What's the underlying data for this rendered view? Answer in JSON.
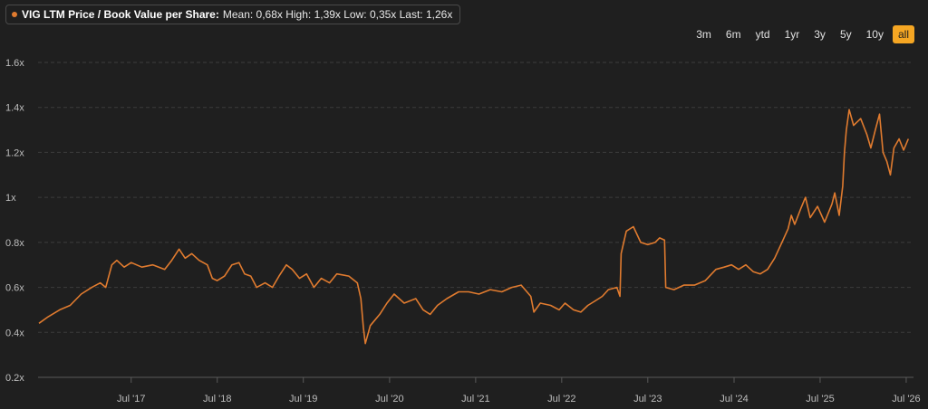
{
  "legend": {
    "series_name": "VIG LTM Price / Book Value per Share:",
    "stats": "Mean: 0,68x High: 1,39x Low: 0,35x Last: 1,26x"
  },
  "range_buttons": [
    {
      "label": "3m",
      "active": false
    },
    {
      "label": "6m",
      "active": false
    },
    {
      "label": "ytd",
      "active": false
    },
    {
      "label": "1yr",
      "active": false
    },
    {
      "label": "3y",
      "active": false
    },
    {
      "label": "5y",
      "active": false
    },
    {
      "label": "10y",
      "active": false
    },
    {
      "label": "all",
      "active": true
    }
  ],
  "colors": {
    "series": "#e07b2f",
    "background": "#1f1f1f",
    "grid": "#3c3c3c",
    "active_button": "#f5a623"
  },
  "chart_data": {
    "type": "line",
    "title": "",
    "xlabel": "",
    "ylabel": "",
    "ylim": [
      0.2,
      1.6
    ],
    "y_ticks": [
      {
        "value": 0.2,
        "label": "0.2x"
      },
      {
        "value": 0.4,
        "label": "0.4x"
      },
      {
        "value": 0.6,
        "label": "0.6x"
      },
      {
        "value": 0.8,
        "label": "0.8x"
      },
      {
        "value": 1.0,
        "label": "1x"
      },
      {
        "value": 1.2,
        "label": "1.2x"
      },
      {
        "value": 1.4,
        "label": "1.4x"
      },
      {
        "value": 1.6,
        "label": "1.6x"
      }
    ],
    "xlim": [
      "2016-06-01",
      "2026-08-01"
    ],
    "x_ticks": [
      {
        "value": "2017-07-01",
        "label": "Jul '17"
      },
      {
        "value": "2018-07-01",
        "label": "Jul '18"
      },
      {
        "value": "2019-07-01",
        "label": "Jul '19"
      },
      {
        "value": "2020-07-01",
        "label": "Jul '20"
      },
      {
        "value": "2021-07-01",
        "label": "Jul '21"
      },
      {
        "value": "2022-07-01",
        "label": "Jul '22"
      },
      {
        "value": "2023-07-01",
        "label": "Jul '23"
      },
      {
        "value": "2024-07-01",
        "label": "Jul '24"
      },
      {
        "value": "2025-07-01",
        "label": "Jul '25"
      },
      {
        "value": "2026-07-01",
        "label": "Jul '26"
      }
    ],
    "grid": true,
    "series": [
      {
        "points": [
          [
            "2016-06-05",
            0.44
          ],
          [
            "2016-07-15",
            0.47
          ],
          [
            "2016-09-01",
            0.5
          ],
          [
            "2016-10-15",
            0.52
          ],
          [
            "2016-12-01",
            0.57
          ],
          [
            "2017-01-15",
            0.6
          ],
          [
            "2017-02-20",
            0.62
          ],
          [
            "2017-03-15",
            0.6
          ],
          [
            "2017-04-10",
            0.7
          ],
          [
            "2017-05-01",
            0.72
          ],
          [
            "2017-06-01",
            0.69
          ],
          [
            "2017-07-01",
            0.71
          ],
          [
            "2017-08-15",
            0.69
          ],
          [
            "2017-10-01",
            0.7
          ],
          [
            "2017-11-20",
            0.68
          ],
          [
            "2017-12-20",
            0.72
          ],
          [
            "2018-01-20",
            0.77
          ],
          [
            "2018-02-15",
            0.73
          ],
          [
            "2018-03-15",
            0.75
          ],
          [
            "2018-04-15",
            0.72
          ],
          [
            "2018-05-20",
            0.7
          ],
          [
            "2018-06-10",
            0.64
          ],
          [
            "2018-07-01",
            0.63
          ],
          [
            "2018-08-01",
            0.65
          ],
          [
            "2018-09-01",
            0.7
          ],
          [
            "2018-10-01",
            0.71
          ],
          [
            "2018-10-25",
            0.66
          ],
          [
            "2018-11-20",
            0.65
          ],
          [
            "2018-12-15",
            0.6
          ],
          [
            "2019-01-20",
            0.62
          ],
          [
            "2019-02-20",
            0.6
          ],
          [
            "2019-03-20",
            0.65
          ],
          [
            "2019-04-20",
            0.7
          ],
          [
            "2019-05-15",
            0.68
          ],
          [
            "2019-06-15",
            0.64
          ],
          [
            "2019-07-15",
            0.66
          ],
          [
            "2019-08-15",
            0.6
          ],
          [
            "2019-09-15",
            0.64
          ],
          [
            "2019-10-20",
            0.62
          ],
          [
            "2019-11-20",
            0.66
          ],
          [
            "2020-01-10",
            0.65
          ],
          [
            "2020-02-15",
            0.62
          ],
          [
            "2020-03-01",
            0.55
          ],
          [
            "2020-03-12",
            0.42
          ],
          [
            "2020-03-20",
            0.35
          ],
          [
            "2020-04-10",
            0.43
          ],
          [
            "2020-05-20",
            0.48
          ],
          [
            "2020-06-20",
            0.53
          ],
          [
            "2020-07-20",
            0.57
          ],
          [
            "2020-09-01",
            0.53
          ],
          [
            "2020-10-20",
            0.55
          ],
          [
            "2020-11-20",
            0.5
          ],
          [
            "2020-12-20",
            0.48
          ],
          [
            "2021-01-20",
            0.52
          ],
          [
            "2021-03-01",
            0.55
          ],
          [
            "2021-04-20",
            0.58
          ],
          [
            "2021-06-01",
            0.58
          ],
          [
            "2021-07-15",
            0.57
          ],
          [
            "2021-09-01",
            0.59
          ],
          [
            "2021-10-20",
            0.58
          ],
          [
            "2021-12-01",
            0.6
          ],
          [
            "2022-01-10",
            0.61
          ],
          [
            "2022-02-20",
            0.56
          ],
          [
            "2022-03-05",
            0.49
          ],
          [
            "2022-04-01",
            0.53
          ],
          [
            "2022-05-15",
            0.52
          ],
          [
            "2022-06-20",
            0.5
          ],
          [
            "2022-07-15",
            0.53
          ],
          [
            "2022-08-20",
            0.5
          ],
          [
            "2022-09-20",
            0.49
          ],
          [
            "2022-10-20",
            0.52
          ],
          [
            "2022-11-20",
            0.54
          ],
          [
            "2022-12-20",
            0.56
          ],
          [
            "2023-01-15",
            0.59
          ],
          [
            "2023-02-20",
            0.6
          ],
          [
            "2023-03-05",
            0.56
          ],
          [
            "2023-03-10",
            0.75
          ],
          [
            "2023-04-01",
            0.85
          ],
          [
            "2023-05-01",
            0.87
          ],
          [
            "2023-06-01",
            0.8
          ],
          [
            "2023-07-01",
            0.79
          ],
          [
            "2023-08-01",
            0.8
          ],
          [
            "2023-08-20",
            0.82
          ],
          [
            "2023-09-10",
            0.81
          ],
          [
            "2023-09-15",
            0.6
          ],
          [
            "2023-10-20",
            0.59
          ],
          [
            "2023-12-01",
            0.61
          ],
          [
            "2024-01-15",
            0.61
          ],
          [
            "2024-03-01",
            0.63
          ],
          [
            "2024-04-15",
            0.68
          ],
          [
            "2024-05-20",
            0.69
          ],
          [
            "2024-06-20",
            0.7
          ],
          [
            "2024-07-20",
            0.68
          ],
          [
            "2024-08-20",
            0.7
          ],
          [
            "2024-09-20",
            0.67
          ],
          [
            "2024-10-20",
            0.66
          ],
          [
            "2024-11-20",
            0.68
          ],
          [
            "2024-12-20",
            0.73
          ],
          [
            "2025-01-20",
            0.8
          ],
          [
            "2025-02-15",
            0.86
          ],
          [
            "2025-03-01",
            0.92
          ],
          [
            "2025-03-15",
            0.88
          ],
          [
            "2025-04-10",
            0.95
          ],
          [
            "2025-04-30",
            1.0
          ],
          [
            "2025-05-20",
            0.91
          ],
          [
            "2025-06-20",
            0.96
          ],
          [
            "2025-07-20",
            0.89
          ],
          [
            "2025-08-20",
            0.97
          ],
          [
            "2025-09-01",
            1.02
          ],
          [
            "2025-09-20",
            0.92
          ],
          [
            "2025-10-05",
            1.05
          ],
          [
            "2025-10-12",
            1.2
          ],
          [
            "2025-10-20",
            1.3
          ],
          [
            "2025-11-01",
            1.39
          ],
          [
            "2025-11-20",
            1.32
          ],
          [
            "2025-12-20",
            1.35
          ],
          [
            "2026-01-15",
            1.28
          ],
          [
            "2026-02-01",
            1.22
          ],
          [
            "2026-02-20",
            1.3
          ],
          [
            "2026-03-10",
            1.37
          ],
          [
            "2026-03-25",
            1.2
          ],
          [
            "2026-04-10",
            1.16
          ],
          [
            "2026-04-25",
            1.1
          ],
          [
            "2026-05-10",
            1.22
          ],
          [
            "2026-06-01",
            1.26
          ],
          [
            "2026-06-20",
            1.21
          ],
          [
            "2026-07-10",
            1.26
          ]
        ]
      }
    ]
  }
}
